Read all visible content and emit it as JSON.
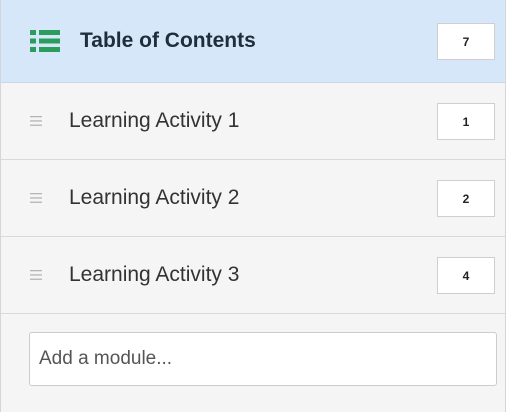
{
  "header": {
    "title": "Table of Contents",
    "count": "7",
    "icon": "list-icon",
    "icon_color": "#2a9d5c"
  },
  "items": [
    {
      "label": "Learning Activity 1",
      "count": "1",
      "icon": "drag-handle-icon"
    },
    {
      "label": "Learning Activity 2",
      "count": "2",
      "icon": "drag-handle-icon"
    },
    {
      "label": "Learning Activity 3",
      "count": "4",
      "icon": "drag-handle-icon"
    }
  ],
  "add_module": {
    "placeholder": "Add a module...",
    "value": ""
  },
  "colors": {
    "header_bg": "#d6e7fa",
    "panel_bg": "#f5f5f5",
    "accent": "#2a9d5c"
  }
}
